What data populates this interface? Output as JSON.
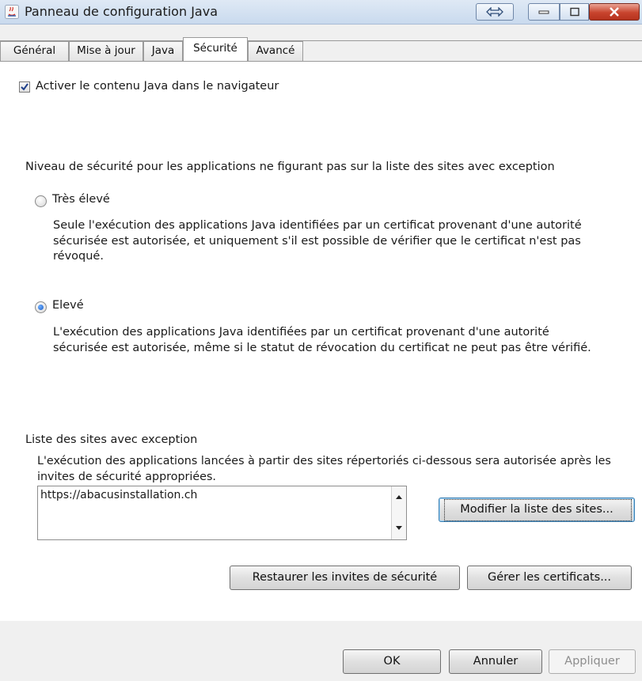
{
  "window": {
    "title": "Panneau de configuration Java"
  },
  "tabs": [
    {
      "label": "Général"
    },
    {
      "label": "Mise à jour"
    },
    {
      "label": "Java"
    },
    {
      "label": "Sécurité"
    },
    {
      "label": "Avancé"
    }
  ],
  "security": {
    "enable_java_label": "Activer le contenu Java dans le navigateur",
    "enable_java_checked": true,
    "level_heading": "Niveau de sécurité pour les applications ne figurant pas sur la liste des sites avec exception",
    "very_high": {
      "label": "Très élevé",
      "desc_line1": "Seule l'exécution des applications Java identifiées par un certificat provenant d'une autorité",
      "desc_line2": "sécurisée est autorisée, et uniquement s'il est possible de vérifier que le certificat n'est pas",
      "desc_line3": "révoqué.",
      "selected": false
    },
    "high": {
      "label": "Elevé",
      "desc_line1": "L'exécution des applications Java identifiées par un certificat provenant d'une autorité",
      "desc_line2": "sécurisée est autorisée, même si le statut de révocation du certificat ne peut pas être vérifié.",
      "selected": true
    },
    "exceptions": {
      "heading": "Liste des sites avec exception",
      "desc_line1": "L'exécution des applications lancées à partir des sites répertoriés ci-dessous sera autorisée après les",
      "desc_line2": "invites de sécurité appropriées.",
      "sites": [
        "https://abacusinstallation.ch"
      ],
      "edit_button": "Modifier la liste des sites..."
    },
    "restore_prompts_button": "Restaurer les invites de sécurité",
    "manage_certs_button": "Gérer les certificats..."
  },
  "footer": {
    "ok": "OK",
    "cancel": "Annuler",
    "apply": "Appliquer"
  }
}
